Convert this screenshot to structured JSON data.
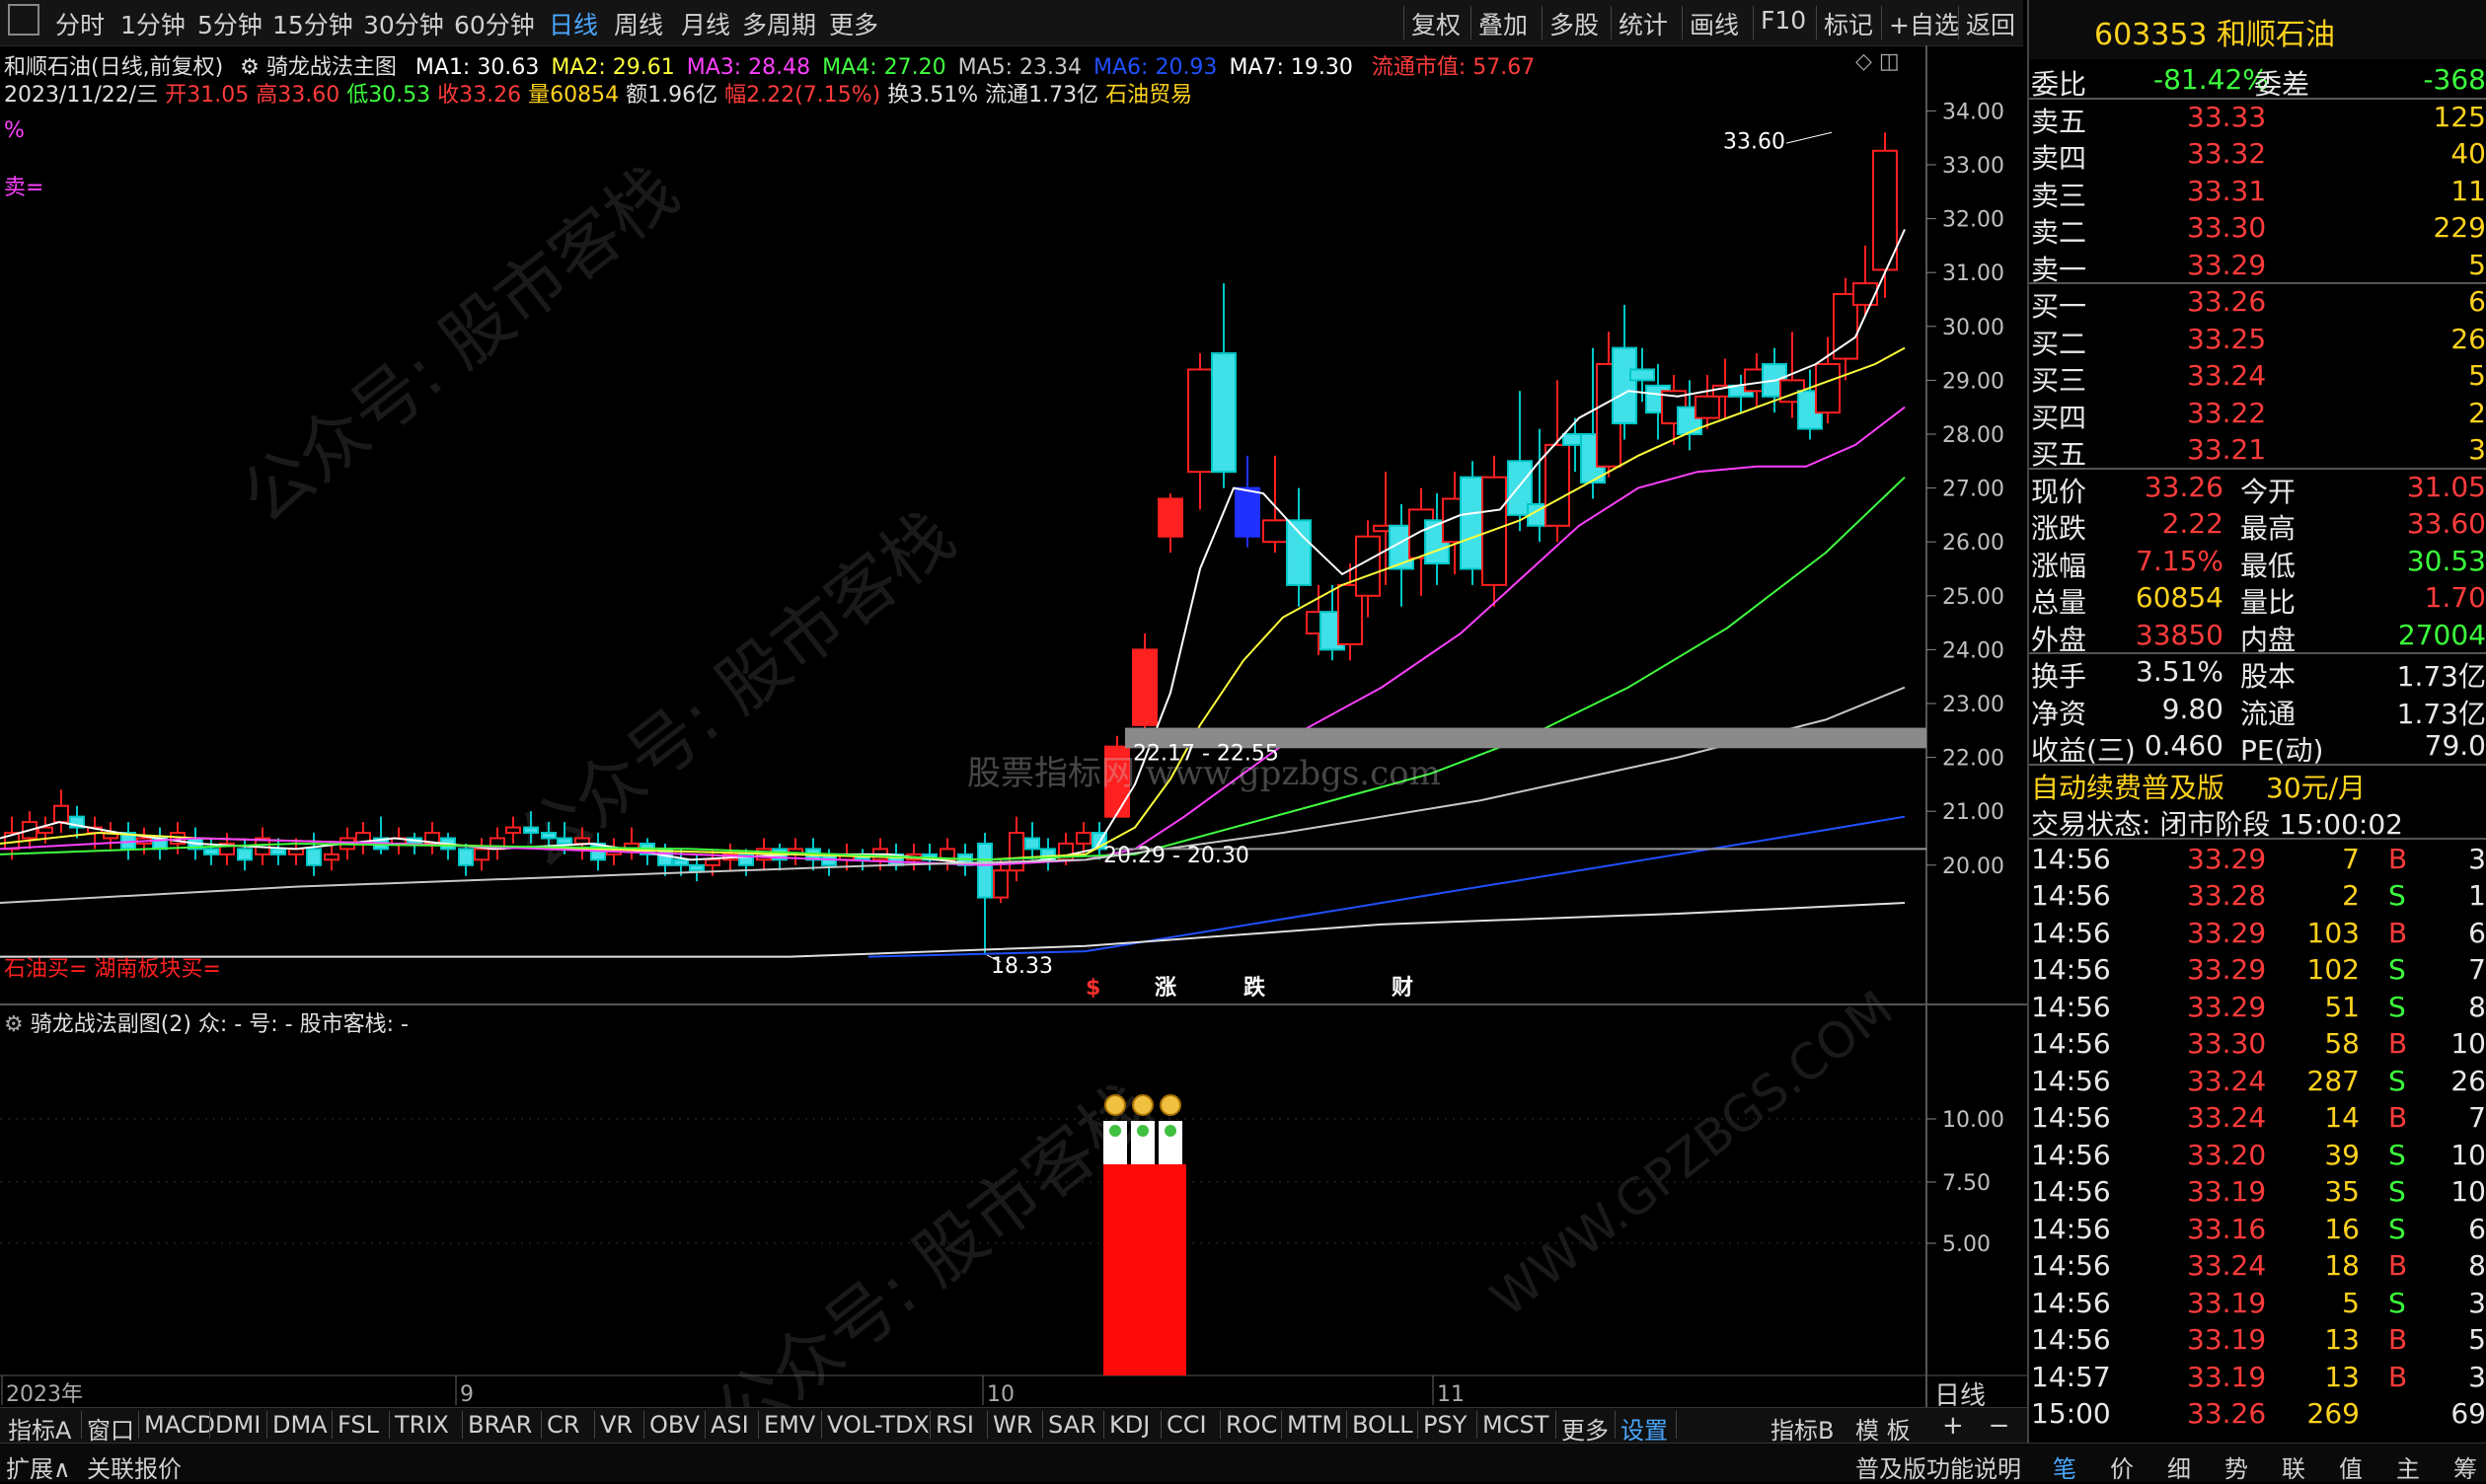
{
  "toolbar": {
    "left": [
      "分时",
      "1分钟",
      "5分钟",
      "15分钟",
      "30分钟",
      "60分钟",
      "日线",
      "周线",
      "月线",
      "多周期",
      "更多"
    ],
    "active": "日线",
    "right": [
      "复权",
      "叠加",
      "多股",
      "统计",
      "画线",
      "F10",
      "标记",
      "+自选",
      "返回"
    ]
  },
  "stock_header": {
    "code_name": "603353 和顺石油"
  },
  "chart_info": {
    "line1_prefix": "和顺石油(日线,前复权)",
    "indicator": "骑龙战法主图",
    "ma": [
      {
        "label": "MA1: 30.63",
        "color": "#ffffff"
      },
      {
        "label": "MA2: 29.61",
        "color": "#ffff3c"
      },
      {
        "label": "MA3: 28.48",
        "color": "#ff40ff"
      },
      {
        "label": "MA4: 27.20",
        "color": "#40ff40"
      },
      {
        "label": "MA5: 23.34",
        "color": "#c8c8c8"
      },
      {
        "label": "MA6: 20.93",
        "color": "#2050ff"
      },
      {
        "label": "MA7: 19.30",
        "color": "#ffffff"
      }
    ],
    "market_cap": "流通市值: 57.67",
    "date": "2023/11/22/三",
    "open": "开31.05",
    "high": "高33.60",
    "low": "低30.53",
    "close": "收33.26",
    "volume": "量60854",
    "amount": "额1.96亿",
    "amp": "幅2.22(7.15%)",
    "turnover": "换3.51%",
    "float": "流通1.73亿",
    "sector": "石油贸易",
    "pct": "%",
    "sell_label": "卖=",
    "bottom_label": "石油买= 湖南板块买=",
    "high_marker": "33.60",
    "low_marker": "18.33",
    "level1": "22.17 - 22.55",
    "level2": "20.29 - 20.30",
    "center_wm": "股票指标网 www.gpzbgs.com",
    "signals": [
      {
        "text": "$",
        "color": "#ff3030"
      },
      {
        "text": "涨",
        "color": "#ffffff",
        "bg": "#b00000"
      },
      {
        "text": "跌",
        "color": "#ffffff",
        "bg": "#108010"
      },
      {
        "text": "财",
        "color": "#ffffff",
        "bg": "#2040a0"
      }
    ]
  },
  "chart_data": {
    "type": "candlestick",
    "y_ticks": [
      "34.00",
      "33.00",
      "32.00",
      "31.00",
      "30.00",
      "29.00",
      "28.00",
      "27.00",
      "26.00",
      "25.00",
      "24.00",
      "23.00",
      "22.00",
      "21.00",
      "20.00"
    ],
    "x_labels": [
      "2023年",
      "9",
      "10",
      "11"
    ],
    "last_close": 33.26,
    "high": 33.6,
    "low": 18.33
  },
  "sub_chart": {
    "title": "骑龙战法副图(2) 众: - 号: - 股市客栈: -",
    "y_ticks": [
      "10.00",
      "7.50",
      "5.00"
    ]
  },
  "quote": {
    "weibi": {
      "label": "委比",
      "value": "-81.42%",
      "label2": "委差",
      "value2": "-368"
    },
    "asks": [
      {
        "label": "卖五",
        "price": "33.33",
        "vol": "125"
      },
      {
        "label": "卖四",
        "price": "33.32",
        "vol": "40"
      },
      {
        "label": "卖三",
        "price": "33.31",
        "vol": "11"
      },
      {
        "label": "卖二",
        "price": "33.30",
        "vol": "229"
      },
      {
        "label": "卖一",
        "price": "33.29",
        "vol": "5"
      }
    ],
    "bids": [
      {
        "label": "买一",
        "price": "33.26",
        "vol": "6"
      },
      {
        "label": "买二",
        "price": "33.25",
        "vol": "26"
      },
      {
        "label": "买三",
        "price": "33.24",
        "vol": "5"
      },
      {
        "label": "买四",
        "price": "33.22",
        "vol": "2"
      },
      {
        "label": "买五",
        "price": "33.21",
        "vol": "3"
      }
    ],
    "stats": [
      {
        "l1": "现价",
        "v1": "33.26",
        "c1": "red",
        "l2": "今开",
        "v2": "31.05",
        "c2": "red"
      },
      {
        "l1": "涨跌",
        "v1": "2.22",
        "c1": "red",
        "l2": "最高",
        "v2": "33.60",
        "c2": "red"
      },
      {
        "l1": "涨幅",
        "v1": "7.15%",
        "c1": "red",
        "l2": "最低",
        "v2": "30.53",
        "c2": "green"
      },
      {
        "l1": "总量",
        "v1": "60854",
        "c1": "yellow",
        "l2": "量比",
        "v2": "1.70",
        "c2": "red"
      },
      {
        "l1": "外盘",
        "v1": "33850",
        "c1": "red",
        "l2": "内盘",
        "v2": "27004",
        "c2": "green"
      }
    ],
    "stats2": [
      {
        "l1": "换手",
        "v1": "3.51%",
        "l2": "股本",
        "v2": "1.73亿"
      },
      {
        "l1": "净资",
        "v1": "9.80",
        "l2": "流通",
        "v2": "1.73亿"
      },
      {
        "l1": "收益(三)",
        "v1": "0.460",
        "l2": "PE(动)",
        "v2": "79.0"
      }
    ],
    "promo": "自动续费普及版",
    "promo_price": "30元/月",
    "trade_status": "交易状态: 闭市阶段 15:00:02",
    "ticks": [
      {
        "t": "14:56",
        "p": "33.29",
        "v": "7",
        "s": "B",
        "n": "3"
      },
      {
        "t": "14:56",
        "p": "33.28",
        "v": "2",
        "s": "S",
        "n": "1"
      },
      {
        "t": "14:56",
        "p": "33.29",
        "v": "103",
        "s": "B",
        "n": "6"
      },
      {
        "t": "14:56",
        "p": "33.29",
        "v": "102",
        "s": "S",
        "n": "7"
      },
      {
        "t": "14:56",
        "p": "33.29",
        "v": "51",
        "s": "S",
        "n": "8"
      },
      {
        "t": "14:56",
        "p": "33.30",
        "v": "58",
        "s": "B",
        "n": "10"
      },
      {
        "t": "14:56",
        "p": "33.24",
        "v": "287",
        "s": "S",
        "n": "26"
      },
      {
        "t": "14:56",
        "p": "33.24",
        "v": "14",
        "s": "B",
        "n": "7"
      },
      {
        "t": "14:56",
        "p": "33.20",
        "v": "39",
        "s": "S",
        "n": "10"
      },
      {
        "t": "14:56",
        "p": "33.19",
        "v": "35",
        "s": "S",
        "n": "10"
      },
      {
        "t": "14:56",
        "p": "33.16",
        "v": "16",
        "s": "S",
        "n": "6"
      },
      {
        "t": "14:56",
        "p": "33.24",
        "v": "18",
        "s": "B",
        "n": "8"
      },
      {
        "t": "14:56",
        "p": "33.19",
        "v": "5",
        "s": "S",
        "n": "3"
      },
      {
        "t": "14:56",
        "p": "33.19",
        "v": "13",
        "s": "B",
        "n": "5"
      },
      {
        "t": "14:57",
        "p": "33.19",
        "v": "13",
        "s": "B",
        "n": "3"
      },
      {
        "t": "15:00",
        "p": "33.26",
        "v": "269",
        "s": "",
        "n": "69"
      }
    ]
  },
  "indicator_tabs": [
    "指标A",
    "窗口",
    "MACD",
    "DMI",
    "DMA",
    "FSL",
    "TRIX",
    "BRAR",
    "CR",
    "VR",
    "OBV",
    "ASI",
    "EMV",
    "VOL-TDX",
    "RSI",
    "WR",
    "SAR",
    "KDJ",
    "CCI",
    "ROC",
    "MTM",
    "BOLL",
    "PSY",
    "MCST",
    "更多",
    "设置"
  ],
  "indicator_right": [
    "指标B",
    "模 板"
  ],
  "period_label": "日线",
  "status_left": [
    "扩展∧",
    "关联报价"
  ],
  "status_right": {
    "func": "普及版功能说明",
    "tabs": [
      "笔",
      "价",
      "细",
      "势",
      "联",
      "值",
      "主",
      "筹"
    ]
  }
}
